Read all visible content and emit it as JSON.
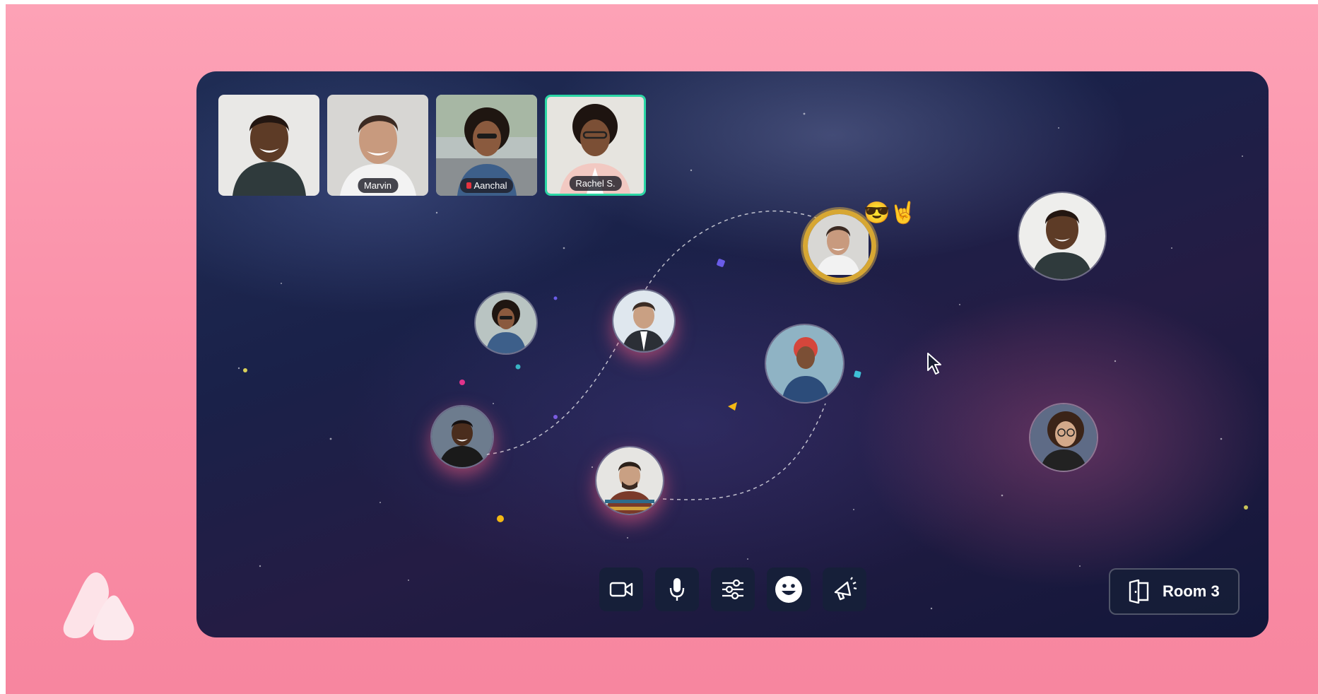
{
  "colors": {
    "page_background": "#fa99ae",
    "space_background": "#1c2350",
    "active_tile_border": "#2bd6a5",
    "speaker_ring": "#d7a733",
    "toolbar_button": "#16203a"
  },
  "video_tiles": [
    {
      "name": "",
      "active": false,
      "muted": false
    },
    {
      "name": "Marvin",
      "active": false,
      "muted": false
    },
    {
      "name": "Aanchal",
      "active": false,
      "muted": true
    },
    {
      "name": "Rachel S.",
      "active": true,
      "muted": false
    }
  ],
  "reaction": {
    "emoji": "😎🤘"
  },
  "toolbar": {
    "buttons": [
      "camera-icon",
      "microphone-icon",
      "settings-sliders-icon",
      "emoji-icon",
      "megaphone-icon"
    ]
  },
  "room": {
    "label": "Room 3",
    "icon": "door-icon"
  }
}
